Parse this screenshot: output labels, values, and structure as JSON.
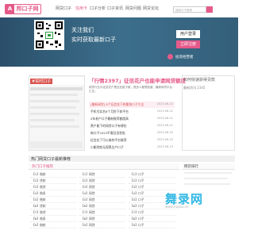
{
  "header": {
    "logo_text": "邦口子网",
    "logo_mark": "A",
    "nav": [
      "网贷口子",
      "信用卡",
      "口子分析",
      "口子资讯",
      "网贷问题",
      "网贷论坛"
    ],
    "nav_active_index": 1,
    "search_placeholder": "搜索口子新闻"
  },
  "banner": {
    "line1": "关注我们",
    "line2": "实时获取最新口子",
    "login": "用户登录",
    "register": "立即注册",
    "consult": "投资经营者"
  },
  "slider": {
    "tag": "#实时口子"
  },
  "news": {
    "headline": "「行情2397」征信花户也能申请网贷额度",
    "desc": "网贷行业中征信花户是否还能下款，很多人都想知道，最新网贷平台汇总。",
    "items": [
      {
        "title": "[最新网贷] 8个征信花下款最快口子大全",
        "date": "2023-06-22"
      },
      {
        "title": "手机号实名6个月秒下款平台",
        "date": "2023-06-22"
      },
      {
        "title": "5年老户口子最新推荐额度高",
        "date": "2023-06-21"
      },
      {
        "title": "黑户能下的网贷口子有哪些",
        "date": "2023-06-21"
      },
      {
        "title": "新口子2023不看征信秒批",
        "date": "2023-06-20"
      },
      {
        "title": "征信花了可以借的平台推荐",
        "date": "2023-06-20"
      },
      {
        "title": "小额贷款无视黑白户口子",
        "date": "2023-06-19"
      }
    ]
  },
  "rightpanel": {
    "title": "如何快速获得贷款",
    "line": "最新资讯 2345"
  },
  "section": {
    "title": "热门网贷口子最新推荐",
    "sub": "热门口子推荐",
    "right_sub": "网贷排行",
    "col1": [
      "【1】借款",
      "【2】贷款",
      "【3】借贷",
      "【4】借条",
      "【5】借款",
      "【6】贷款",
      "【7】借贷",
      "【8】借条",
      "【9】借款"
    ],
    "col2": [
      "【1】网贷",
      "【2】网贷",
      "【3】网贷",
      "【4】网贷",
      "【5】网贷",
      "【6】网贷",
      "【7】网贷",
      "【8】网贷",
      "【9】网贷"
    ],
    "col3": [
      "【1】口子",
      "【2】口子",
      "【3】口子",
      "【4】口子",
      "【5】口子",
      "【6】口子",
      "【7】口子",
      "【8】口子",
      "【9】口子"
    ]
  },
  "watermark": {
    "text": "舞录网",
    "sub": "www.ruiyou.cn"
  },
  "colors": {
    "accent": "#e55a8a",
    "banner": "#2b4f6a",
    "watermark": "#2fb7e3"
  }
}
